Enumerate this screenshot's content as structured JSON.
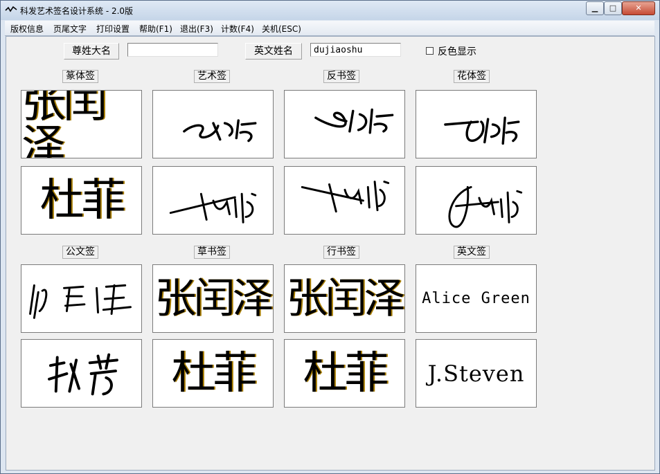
{
  "window": {
    "title": "科发艺术签名设计系统 - 2.0版"
  },
  "menu": [
    "版权信息",
    "页尾文字",
    "打印设置",
    "帮助(F1)",
    "退出(F3)",
    "计数(F4)",
    "关机(ESC)"
  ],
  "form": {
    "chinese_name_label": "尊姓大名",
    "chinese_name_value": "",
    "english_name_label": "英文姓名",
    "english_name_value": "dujiaoshu",
    "invert_label": "反色显示"
  },
  "sections": {
    "zhuanti": "篆体签",
    "yishu": "艺术签",
    "fanshu": "反书签",
    "huati": "花体签",
    "gongwen": "公文签",
    "caoshu": "草书签",
    "xingshu": "行书签",
    "yingwen": "英文签"
  },
  "samples": {
    "name1": "张闰泽",
    "name2": "杜菲",
    "english1": "Alice Green",
    "english2": "J.Steven"
  }
}
